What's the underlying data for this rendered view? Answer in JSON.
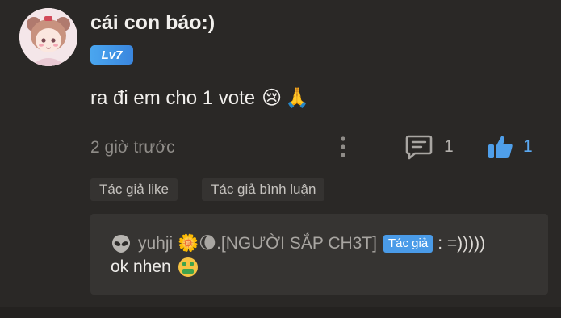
{
  "comment": {
    "username": "cái con báo:)",
    "level": "Lv7",
    "text": "ra đi em cho 1 vote",
    "text_emojis": [
      "😢",
      "🙏"
    ],
    "timestamp": "2 giờ trước",
    "reply_count": "1",
    "like_count": "1"
  },
  "tags": {
    "author_like": "Tác giả like",
    "author_reply": "Tác giả bình luận"
  },
  "reply": {
    "author": "yuhji 🌼🌘.[NGƯỜI SẮP CH3T]",
    "author_badge": "Tác giả",
    "separator": ": =)))))",
    "text": "ok nhen"
  },
  "colors": {
    "background": "#2a2826",
    "accent_blue": "#4a9be8",
    "reply_box": "#363432"
  },
  "icons": [
    "avatar-illustration",
    "more-vertical-icon",
    "comment-icon",
    "thumbs-up-icon",
    "alien-icon",
    "money-mouth-icon"
  ]
}
